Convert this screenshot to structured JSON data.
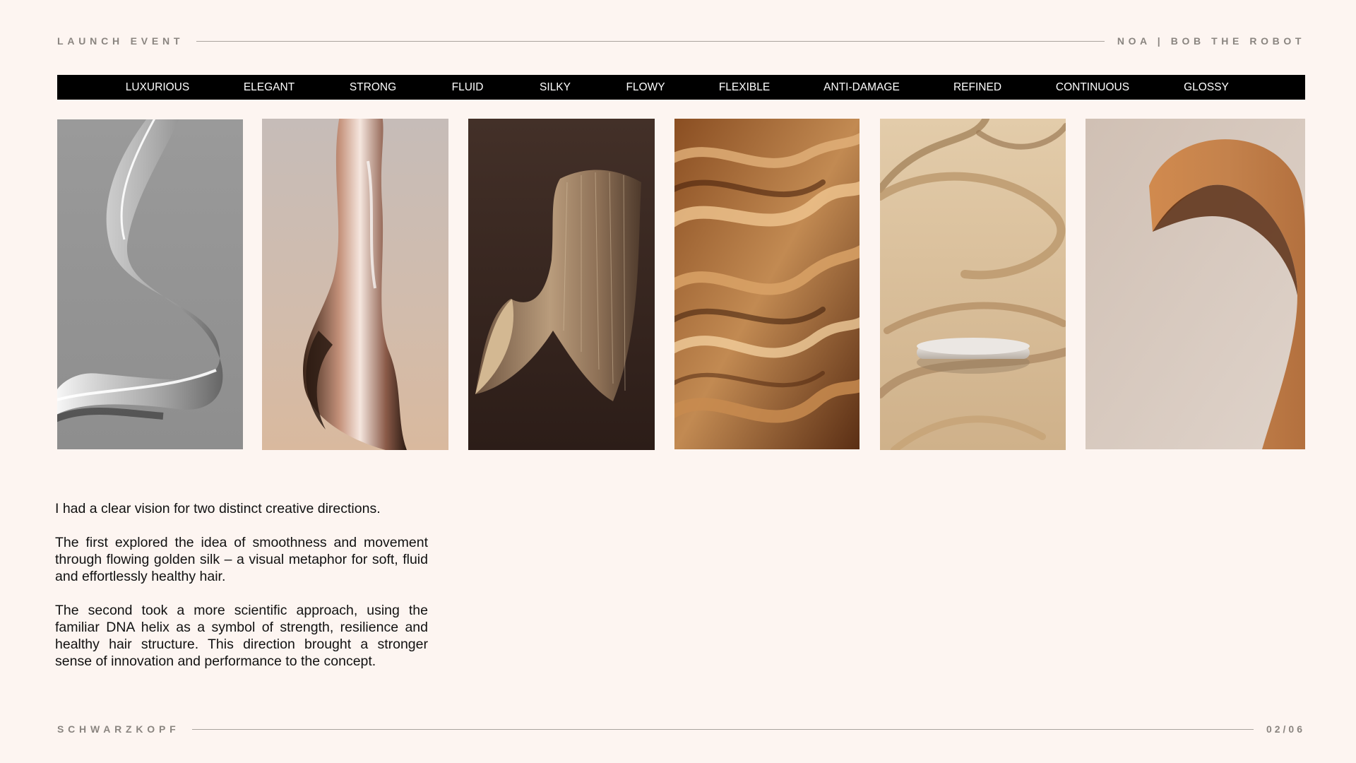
{
  "header": {
    "left_label": "LAUNCH EVENT",
    "right_label": "NOA | BOB THE ROBOT"
  },
  "keywords": [
    "LUXURIOUS",
    "ELEGANT",
    "STRONG",
    "FLUID",
    "SILKY",
    "FLOWY",
    "FLEXIBLE",
    "ANTI-DAMAGE",
    "REFINED",
    "CONTINUOUS",
    "GLOSSY"
  ],
  "moodboard": {
    "tiles": [
      {
        "subject": "clear-liquid-ribbon",
        "background": "#9b9b9b"
      },
      {
        "subject": "chrome-liquid-metal-swirl",
        "background": "#c7b7ad"
      },
      {
        "subject": "brushed-hair-strand-curl",
        "background": "#3d2a24"
      },
      {
        "subject": "wavy-golden-hair-closeup",
        "background": "#a56a34"
      },
      {
        "subject": "golden-silk-ribbons-podium",
        "background": "#dcc3a0"
      },
      {
        "subject": "cork-sheet-curve",
        "background": "#d8cbc0"
      }
    ]
  },
  "body_copy": {
    "paragraph_1": "I had a clear vision for two distinct creative directions.",
    "paragraph_2": "The first explored the idea of smoothness and movement through flowing golden silk – a visual metaphor for soft, fluid and effortlessly healthy hair.",
    "paragraph_3": "The second took a more scientific approach, using the familiar DNA helix as a symbol of strength, resilience and healthy hair structure. This direction brought a stronger sense of innovation and performance to the concept."
  },
  "footer": {
    "left_label": "SCHWARZKOPF",
    "page_indicator": "02/06"
  },
  "colors": {
    "page_background": "#fdf5f1",
    "keyword_bar": "#000000",
    "label_gray": "#8a8580",
    "rule_gray": "#a9a39e"
  }
}
